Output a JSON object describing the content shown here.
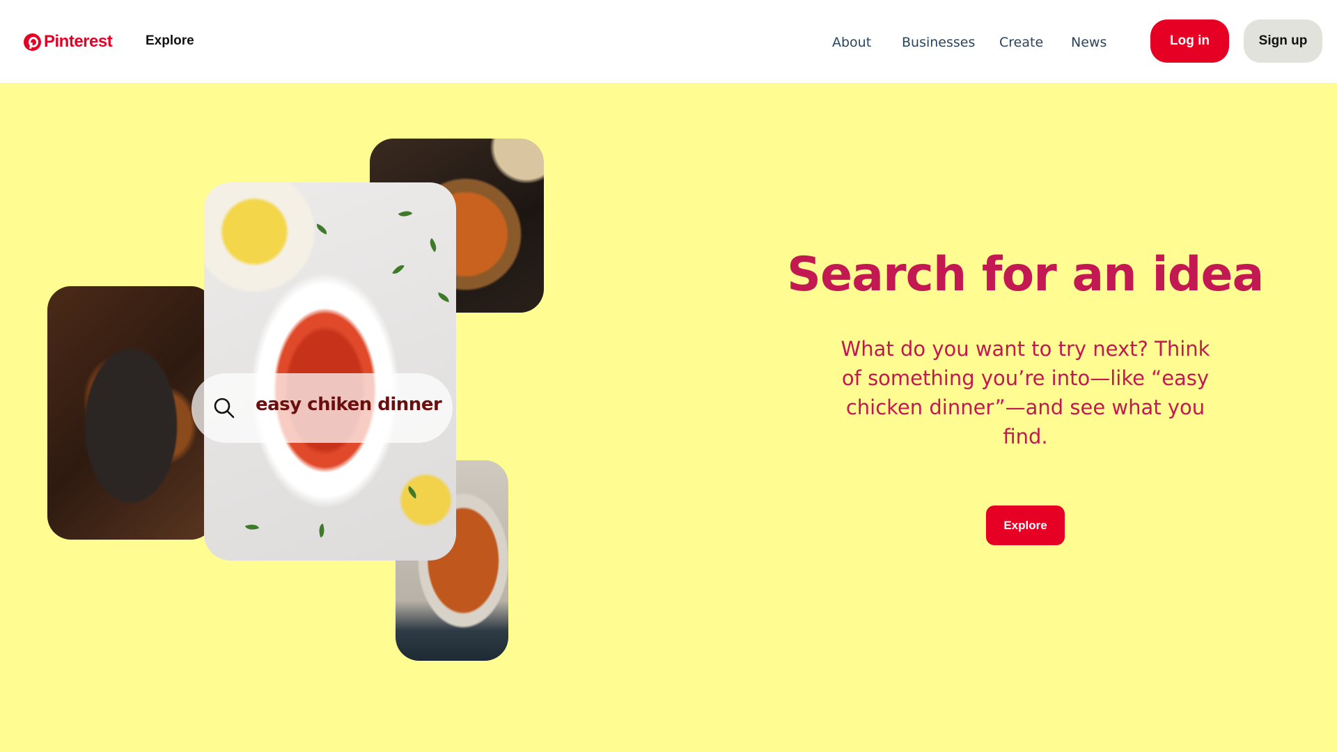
{
  "header": {
    "logo_text": "Pinterest",
    "explore_label": "Explore",
    "nav": [
      {
        "label": "About"
      },
      {
        "label": "Businesses"
      },
      {
        "label": "Create"
      },
      {
        "label": "News"
      }
    ],
    "login_label": "Log in",
    "signup_label": "Sign up"
  },
  "hero": {
    "search_text": "easy chiken dinner",
    "title": "Search for an idea",
    "description": "What do you want to try next? Think of something you’re into—like “easy chicken dinner”—and see what you find.",
    "explore_button": "Explore"
  },
  "colors": {
    "brand": "#e60023",
    "hero_background": "#fffd92",
    "hero_text": "#c31952",
    "nav_text": "#27445e"
  },
  "icons": {
    "logo": "pinterest-logo-icon",
    "search": "search-icon"
  }
}
